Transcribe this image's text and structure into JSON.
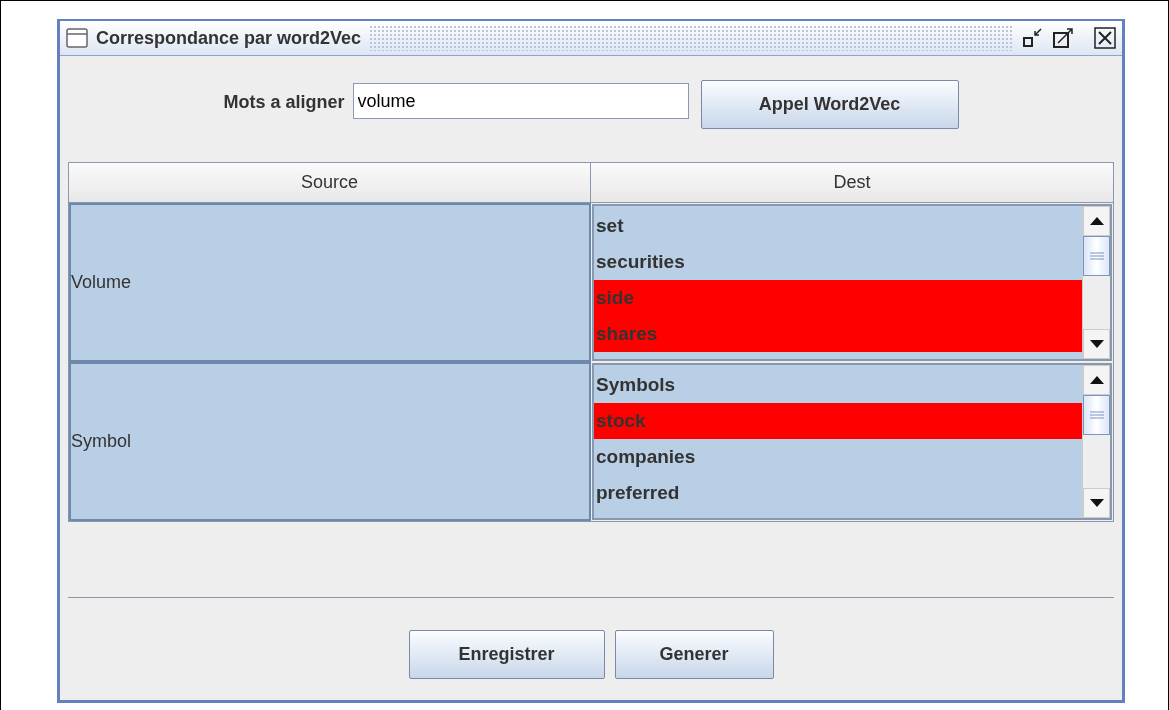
{
  "window": {
    "title": "Correspondance par word2Vec"
  },
  "search": {
    "label": "Mots a aligner",
    "value": "volume",
    "button": "Appel Word2Vec"
  },
  "table": {
    "columns": [
      "Source",
      "Dest"
    ],
    "rows": [
      {
        "source": "Volume",
        "dest": [
          {
            "text": "set",
            "selected": false
          },
          {
            "text": "securities",
            "selected": false
          },
          {
            "text": "side",
            "selected": true
          },
          {
            "text": "shares",
            "selected": true
          }
        ]
      },
      {
        "source": "Symbol",
        "dest": [
          {
            "text": "Symbols",
            "selected": false
          },
          {
            "text": "stock",
            "selected": true
          },
          {
            "text": "companies",
            "selected": false
          },
          {
            "text": "preferred",
            "selected": false
          }
        ]
      }
    ]
  },
  "buttons": [
    "Enregistrer",
    "Generer"
  ]
}
